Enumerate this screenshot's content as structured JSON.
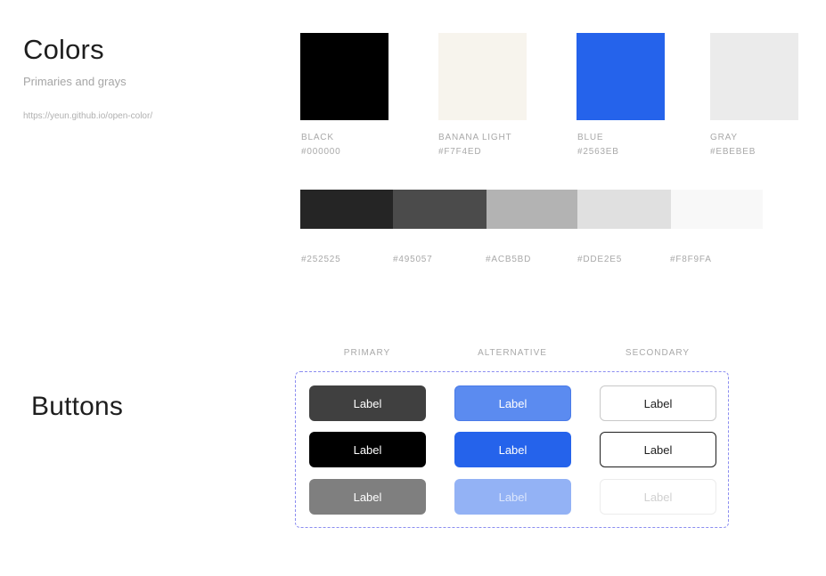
{
  "colors": {
    "title": "Colors",
    "subtitle": "Primaries and grays",
    "link": "https://yeun.github.io/open-color/",
    "primaries": [
      {
        "name": "BLACK",
        "hex": "#000000",
        "color": "#000000"
      },
      {
        "name": "BANANA LIGHT",
        "hex": "#F7F4ED",
        "color": "#F7F4ED"
      },
      {
        "name": "BLUE",
        "hex": "#2563EB",
        "color": "#2563EB"
      },
      {
        "name": "GRAY",
        "hex": "#EBEBEB",
        "color": "#EBEBEB"
      }
    ],
    "grays": [
      {
        "hex": "#252525",
        "color": "#252525"
      },
      {
        "hex": "#495057",
        "color": "#4B4B4B"
      },
      {
        "hex": "#ACB5BD",
        "color": "#B3B3B3"
      },
      {
        "hex": "#DDE2E5",
        "color": "#E0E0E0"
      },
      {
        "hex": "#F8F9FA",
        "color": "#F8F8F8"
      }
    ]
  },
  "buttons": {
    "title": "Buttons",
    "columns": [
      "PRIMARY",
      "ALTERNATIVE",
      "SECONDARY"
    ],
    "label": "Label",
    "primary": [
      "Label",
      "Label",
      "Label"
    ],
    "alternative": [
      "Label",
      "Label",
      "Label"
    ],
    "secondary": [
      "Label",
      "Label",
      "Label"
    ]
  }
}
